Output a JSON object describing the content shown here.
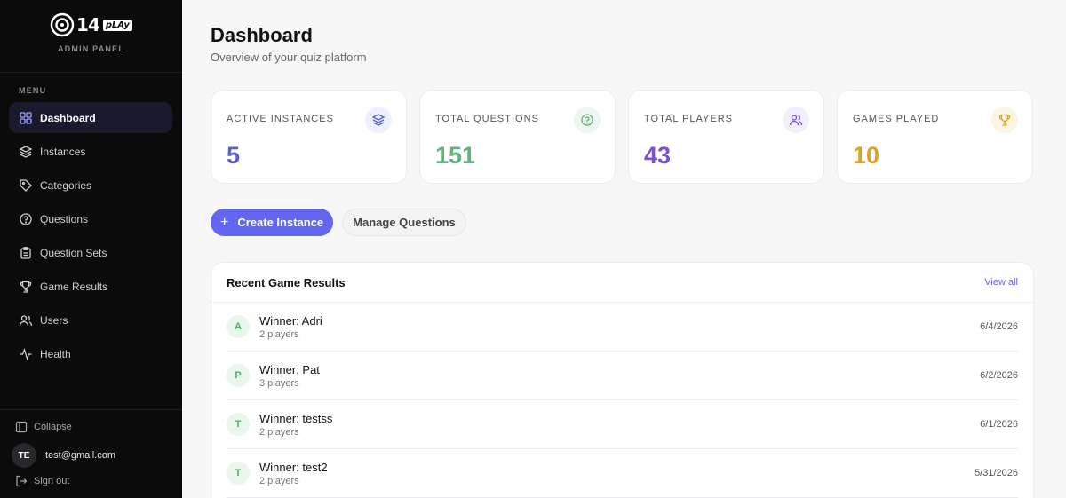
{
  "brand": {
    "logo_num": "14",
    "logo_play": "pLAy",
    "subtitle": "ADMIN PANEL"
  },
  "sidebar": {
    "menu_label": "MENU",
    "items": [
      {
        "label": "Dashboard",
        "icon": "grid-icon",
        "active": true
      },
      {
        "label": "Instances",
        "icon": "layers-icon"
      },
      {
        "label": "Categories",
        "icon": "tag-icon"
      },
      {
        "label": "Questions",
        "icon": "help-circle-icon"
      },
      {
        "label": "Question Sets",
        "icon": "clipboard-icon"
      },
      {
        "label": "Game Results",
        "icon": "trophy-icon"
      },
      {
        "label": "Users",
        "icon": "users-icon"
      },
      {
        "label": "Health",
        "icon": "activity-icon"
      }
    ],
    "collapse_label": "Collapse",
    "user_initials": "TE",
    "user_email": "test@gmail.com",
    "signout_label": "Sign out"
  },
  "header": {
    "title": "Dashboard",
    "subtitle": "Overview of your quiz platform"
  },
  "stats": [
    {
      "label": "ACTIVE INSTANCES",
      "value": "5",
      "color": "#5b5fd6",
      "icon_bg": "#eef0fd",
      "icon": "layers-icon"
    },
    {
      "label": "TOTAL QUESTIONS",
      "value": "151",
      "color": "#5fb477",
      "icon_bg": "#edf7ef",
      "icon": "help-circle-icon"
    },
    {
      "label": "TOTAL PLAYERS",
      "value": "43",
      "color": "#7b4fd6",
      "icon_bg": "#f3eefc",
      "icon": "users-icon"
    },
    {
      "label": "GAMES PLAYED",
      "value": "10",
      "color": "#e0a21a",
      "icon_bg": "#fdf5e3",
      "icon": "trophy-icon"
    }
  ],
  "actions": {
    "create_label": "Create Instance",
    "manage_label": "Manage Questions"
  },
  "recent": {
    "title": "Recent Game Results",
    "view_all": "View all",
    "rows": [
      {
        "initial": "A",
        "winner": "Winner: Adri",
        "players": "2 players",
        "date": "6/4/2026"
      },
      {
        "initial": "P",
        "winner": "Winner: Pat",
        "players": "3 players",
        "date": "6/2/2026"
      },
      {
        "initial": "T",
        "winner": "Winner: testss",
        "players": "2 players",
        "date": "6/1/2026"
      },
      {
        "initial": "T",
        "winner": "Winner: test2",
        "players": "2 players",
        "date": "5/31/2026"
      }
    ]
  }
}
